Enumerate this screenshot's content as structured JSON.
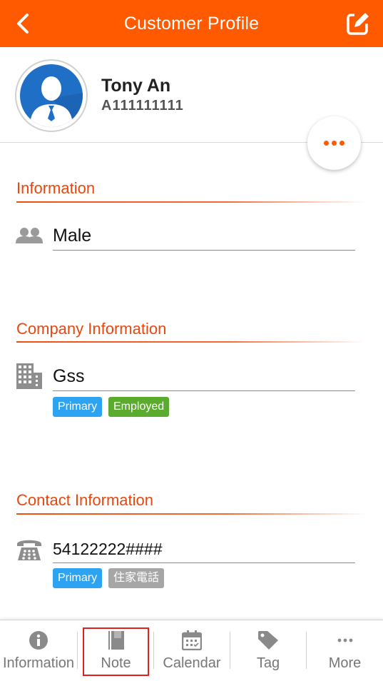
{
  "header": {
    "title": "Customer Profile",
    "back_icon": "chevron-left-icon",
    "edit_icon": "edit-icon",
    "color": "#ff5a00"
  },
  "profile": {
    "name": "Tony An",
    "id": "A111111111",
    "avatar_icon": "person-avatar-icon"
  },
  "sections": {
    "information": {
      "title": "Information",
      "gender": "Male",
      "icon": "people-icon"
    },
    "company": {
      "title": "Company Information",
      "name": "Gss",
      "icon": "building-icon",
      "badges": [
        "Primary",
        "Employed"
      ]
    },
    "contact": {
      "title": "Contact Information",
      "phone": "54122222####",
      "icon": "phone-icon",
      "badges": [
        "Primary",
        "住家電話"
      ]
    }
  },
  "tabs": [
    {
      "label": "Information",
      "icon": "info-icon"
    },
    {
      "label": "Note",
      "icon": "notebook-icon"
    },
    {
      "label": "Calendar",
      "icon": "calendar-icon"
    },
    {
      "label": "Tag",
      "icon": "tag-icon"
    },
    {
      "label": "More",
      "icon": "more-icon"
    }
  ],
  "colors": {
    "accent": "#ff5a00",
    "section_title": "#e9470d",
    "primary_badge": "#2ea3f2",
    "employed_badge": "#5bab2f",
    "gray_badge": "#a6a6a6",
    "highlight_box": "#e02020"
  }
}
